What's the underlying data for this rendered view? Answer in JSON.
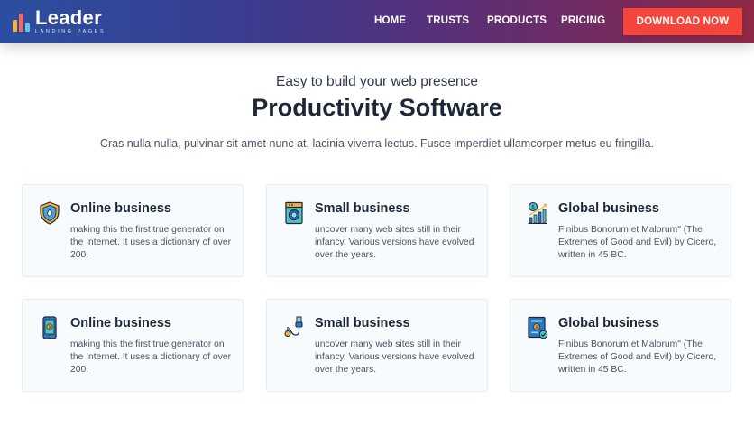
{
  "brand": {
    "name": "Leader",
    "tagline": "LANDING PAGES"
  },
  "nav": {
    "items": [
      {
        "label": "HOME"
      },
      {
        "label": "TRUSTS"
      },
      {
        "label": "PRODUCTS"
      },
      {
        "label": "PRICING"
      }
    ],
    "cta_label": "DOWNLOAD NOW"
  },
  "hero": {
    "eyebrow": "Easy to build your web presence",
    "title": "Productivity Software",
    "lede": "Cras nulla nulla, pulvinar sit amet nunc at, lacinia viverra lectus. Fusce imperdiet ullamcorper metus eu fringilla."
  },
  "features": [
    {
      "icon": "shield-icon",
      "title": "Online business",
      "desc": "making this the first true generator on the Internet. It uses a dictionary of over 200."
    },
    {
      "icon": "washing-machine-icon",
      "title": "Small business",
      "desc": "uncover many web sites still in their infancy. Various versions have evolved over the years."
    },
    {
      "icon": "growth-chart-icon",
      "title": "Global business",
      "desc": "Finibus Bonorum et Malorum\" (The Extremes of Good and Evil) by Cicero, written in 45 BC."
    },
    {
      "icon": "smartphone-icon",
      "title": "Online business",
      "desc": "making this the first true generator on the Internet. It uses a dictionary of over 200."
    },
    {
      "icon": "usb-cable-icon",
      "title": "Small business",
      "desc": "uncover many web sites still in their infancy. Various versions have evolved over the years."
    },
    {
      "icon": "certificate-icon",
      "title": "Global business",
      "desc": "Finibus Bonorum et Malorum\" (The Extremes of Good and Evil) by Cicero, written in 45 BC."
    }
  ],
  "colors": {
    "accent": "#f5453a",
    "nav_gradient_start": "#2b4fa0",
    "nav_gradient_end": "#8f2a46",
    "card_background": "#f7fbfe"
  }
}
